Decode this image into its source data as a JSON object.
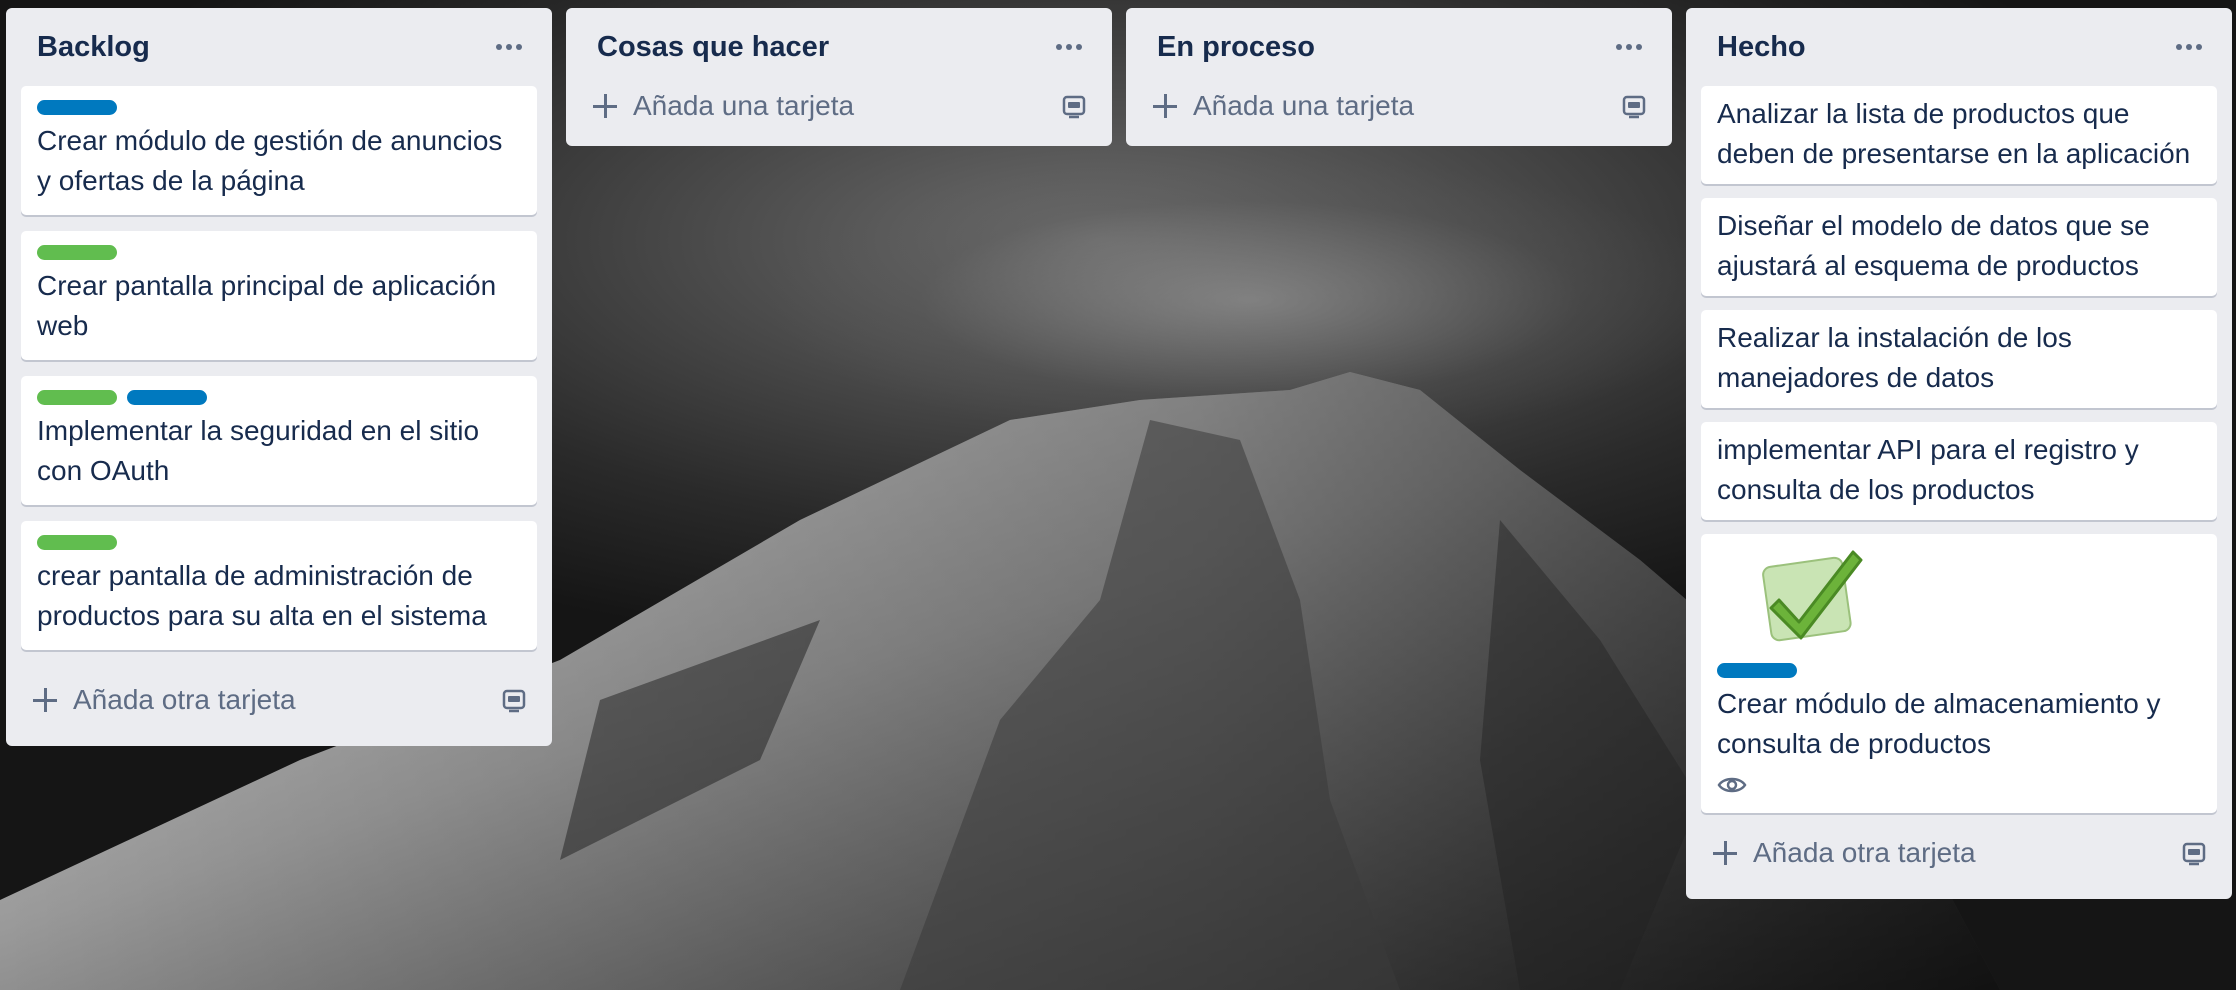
{
  "lists": [
    {
      "title": "Backlog",
      "cards": [
        {
          "labels": [
            "blue"
          ],
          "title": "Crear módulo de gestión de anuncios y ofertas de la página"
        },
        {
          "labels": [
            "green"
          ],
          "title": "Crear pantalla principal de aplicación web"
        },
        {
          "labels": [
            "green",
            "blue"
          ],
          "title": "Implementar la seguridad en el sitio con OAuth"
        },
        {
          "labels": [
            "green"
          ],
          "title": "crear pantalla de administración de productos para su alta en el sistema"
        }
      ],
      "add_label": "Añada otra tarjeta"
    },
    {
      "title": "Cosas que hacer",
      "cards": [],
      "add_label": "Añada una tarjeta"
    },
    {
      "title": "En proceso",
      "cards": [],
      "add_label": "Añada una tarjeta"
    },
    {
      "title": "Hecho",
      "cards": [
        {
          "labels": [],
          "title": "Analizar la lista de productos que deben de presentarse en la aplicación"
        },
        {
          "labels": [],
          "title": "Diseñar el modelo de datos que se ajustará al esquema de productos"
        },
        {
          "labels": [],
          "title": "Realizar la instalación de los manejadores de datos"
        },
        {
          "labels": [],
          "title": "implementar API para el registro y consulta de los productos"
        },
        {
          "labels": [
            "blue"
          ],
          "title": "Crear módulo de almacenamiento y consulta de productos",
          "cover_icon": "green-checkmark-icon",
          "badge_icon": "eye-icon"
        }
      ],
      "add_label": "Añada otra tarjeta"
    }
  ],
  "icons": {
    "list_menu": "ellipsis-icon",
    "add": "plus-icon",
    "template": "card-template-icon"
  },
  "colors": {
    "list_bg": "#ebecf0",
    "card_bg": "#ffffff",
    "text": "#172b4d",
    "muted": "#5e6c84",
    "label_green": "#61bd4f",
    "label_blue": "#0079bf"
  }
}
